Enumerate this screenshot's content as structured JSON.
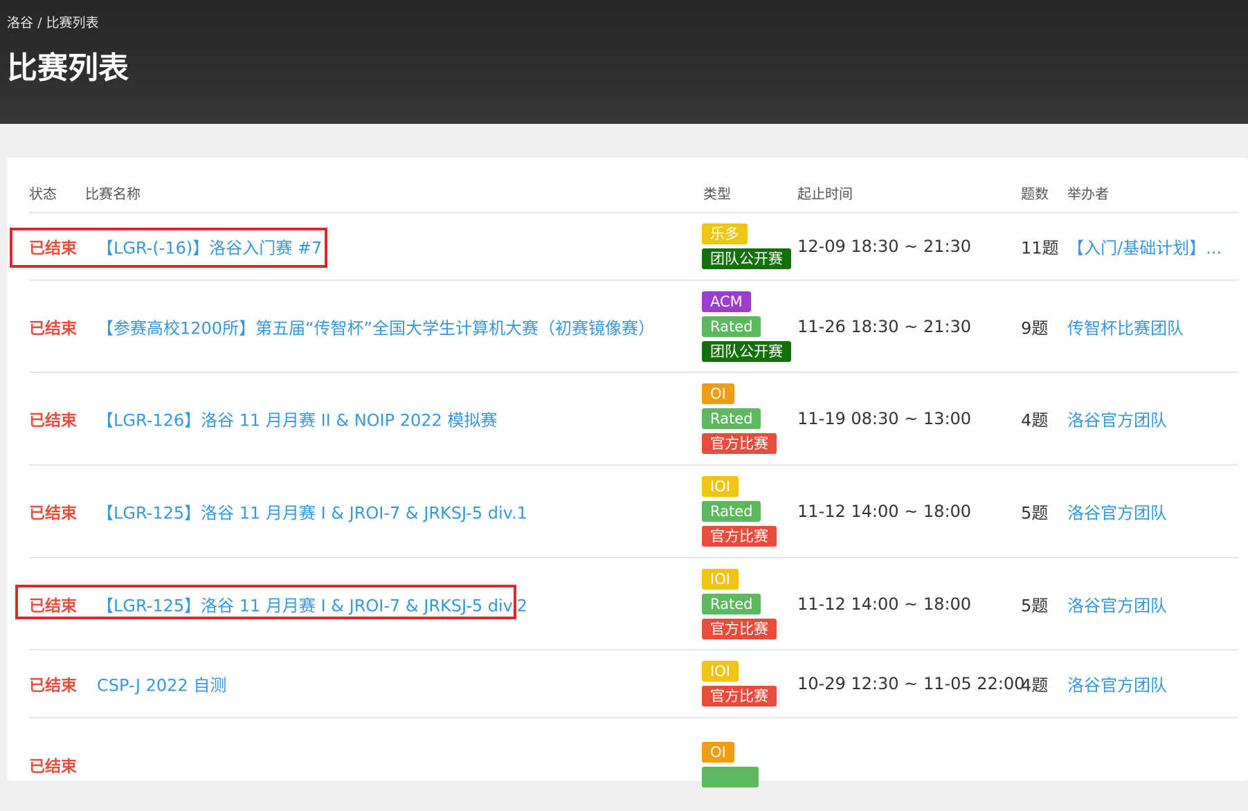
{
  "header": {
    "breadcrumb": {
      "site": "洛谷",
      "separator": "/",
      "current": "比赛列表"
    },
    "title": "比赛列表"
  },
  "table": {
    "columns": {
      "status": "状态",
      "name": "比赛名称",
      "type": "类型",
      "time": "起止时间",
      "count": "题数",
      "host": "举办者"
    },
    "rows": [
      {
        "status": "已结束",
        "name": "【LGR-(-16)】洛谷入门赛 #7",
        "badges": [
          {
            "label": "乐多",
            "color": "#f1c40f"
          },
          {
            "label": "团队公开赛",
            "color": "#14700c"
          }
        ],
        "time": "12-09 18:30 ~ 21:30",
        "count": "11题",
        "host": "【入门/基础计划】..."
      },
      {
        "status": "已结束",
        "name": "【参赛高校1200所】第五届“传智杯”全国大学生计算机大赛（初赛镜像赛）",
        "badges": [
          {
            "label": "ACM",
            "color": "#9d3dcf"
          },
          {
            "label": "Rated",
            "color": "#5eb95e"
          },
          {
            "label": "团队公开赛",
            "color": "#14700c"
          }
        ],
        "time": "11-26 18:30 ~ 21:30",
        "count": "9题",
        "host": "传智杯比赛团队"
      },
      {
        "status": "已结束",
        "name": "【LGR-126】洛谷 11 月月赛 II & NOIP 2022 模拟赛",
        "badges": [
          {
            "label": "OI",
            "color": "#f39c11"
          },
          {
            "label": "Rated",
            "color": "#5eb95e"
          },
          {
            "label": "官方比赛",
            "color": "#e74c3c"
          }
        ],
        "time": "11-19 08:30 ~ 13:00",
        "count": "4题",
        "host": "洛谷官方团队"
      },
      {
        "status": "已结束",
        "name": "【LGR-125】洛谷 11 月月赛 I & JROI-7 & JRKSJ-5 div.1",
        "badges": [
          {
            "label": "IOI",
            "color": "#f1c40f"
          },
          {
            "label": "Rated",
            "color": "#5eb95e"
          },
          {
            "label": "官方比赛",
            "color": "#e74c3c"
          }
        ],
        "time": "11-12 14:00 ~ 18:00",
        "count": "5题",
        "host": "洛谷官方团队"
      },
      {
        "status": "已结束",
        "name": "【LGR-125】洛谷 11 月月赛 I & JROI-7 & JRKSJ-5 div.2",
        "badges": [
          {
            "label": "IOI",
            "color": "#f1c40f"
          },
          {
            "label": "Rated",
            "color": "#5eb95e"
          },
          {
            "label": "官方比赛",
            "color": "#e74c3c"
          }
        ],
        "time": "11-12 14:00 ~ 18:00",
        "count": "5题",
        "host": "洛谷官方团队"
      },
      {
        "status": "已结束",
        "name": "CSP-J 2022 自测",
        "badges": [
          {
            "label": "IOI",
            "color": "#f1c40f"
          },
          {
            "label": "官方比赛",
            "color": "#e74c3c"
          }
        ],
        "time": "10-29 12:30 ~ 11-05 22:00",
        "count": "4题",
        "host": "洛谷官方团队"
      },
      {
        "status": "已结束",
        "name": "",
        "badges": [
          {
            "label": "OI",
            "color": "#f39c11"
          },
          {
            "label": "",
            "color": "#5eb95e"
          }
        ],
        "time": "",
        "count": "",
        "host": ""
      }
    ]
  },
  "annotation": {
    "color": "#e0262d"
  }
}
